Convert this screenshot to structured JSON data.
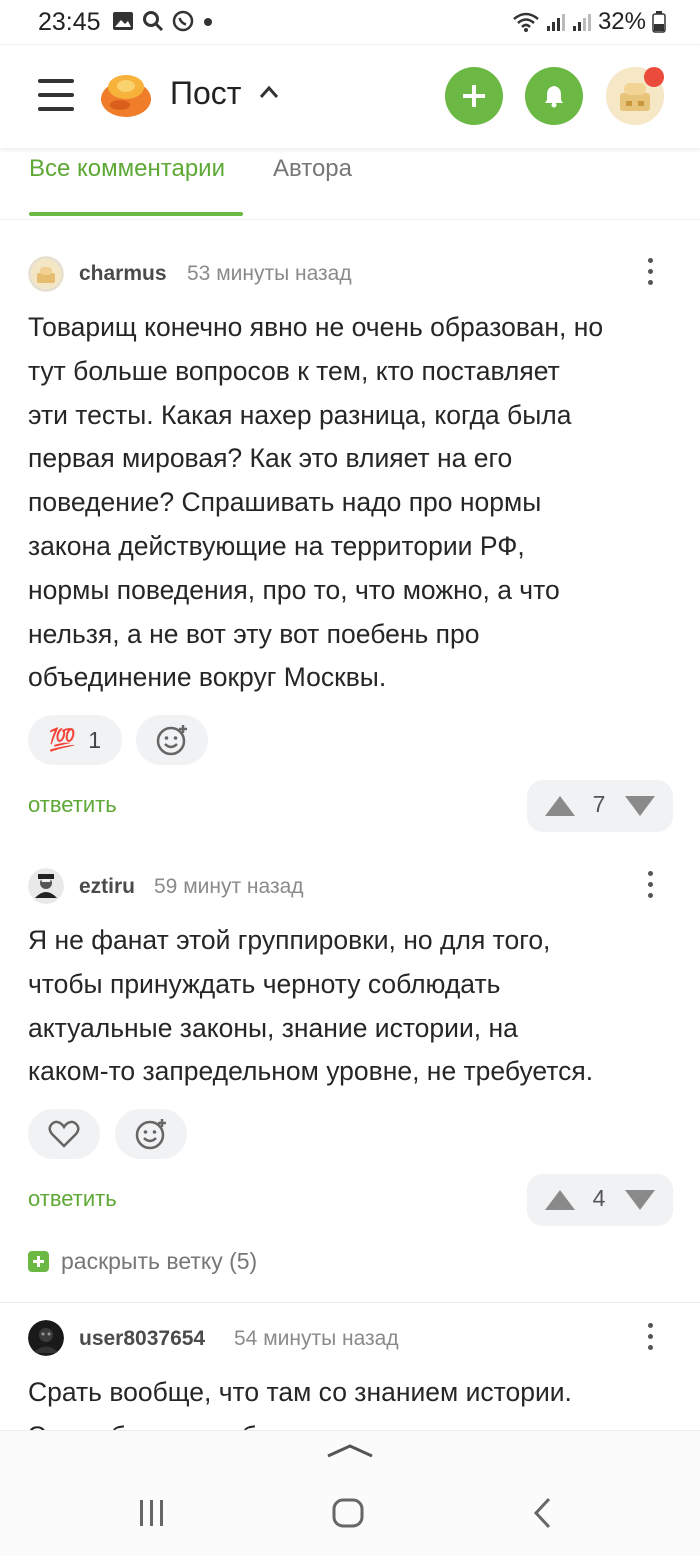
{
  "status_bar": {
    "time": "23:45",
    "battery": "32%"
  },
  "header": {
    "title": "Пост",
    "colors": {
      "accent": "#6bb844",
      "notification_dot": "#ea4b3a"
    }
  },
  "tabs": [
    {
      "label": "Все комментарии",
      "active": true
    },
    {
      "label": "Автора",
      "active": false
    }
  ],
  "comments": [
    {
      "user": "charmus",
      "time": "53 минуты назад",
      "lines": [
        "Товарищ конечно явно не очень образован, но",
        "тут больше вопросов к тем, кто поставляет",
        "эти тесты. Какая нахер разница, когда была",
        "первая мировая? Как это влияет на его",
        "поведение? Спрашивать надо про нормы",
        "закона действующие на территории РФ,",
        "нормы поведения, про то, что можно, а что",
        "нельзя, а не вот эту вот поебень про",
        "объединение вокруг Москвы."
      ],
      "reaction": {
        "emoji": "💯",
        "count": "1"
      },
      "reply_label": "ответить",
      "votes": "7"
    },
    {
      "user": "eztiru",
      "time": "59 минут назад",
      "lines": [
        "Я не фанат этой группировки, но для того,",
        "чтобы принуждать черноту соблюдать",
        "актуальные законы, знание истории, на",
        "каком-то запредельном уровне, не требуется."
      ],
      "reply_label": "ответить",
      "votes": "4",
      "expand_label": "раскрыть ветку (5)"
    },
    {
      "user": "user8037654",
      "time": "54 минуты назад",
      "lines": [
        "Срать вообще, что там со знанием истории.",
        "Эти ребята чуркобесов на место ставят"
      ]
    }
  ]
}
